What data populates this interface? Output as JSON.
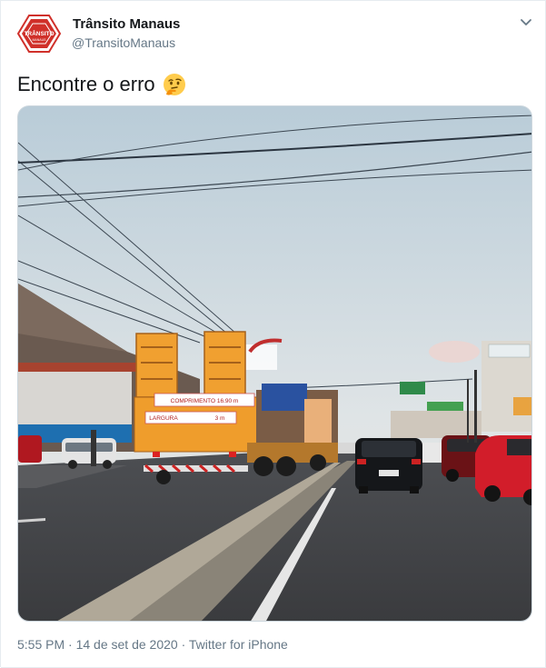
{
  "tweet": {
    "author": {
      "name": "Trânsito Manaus",
      "handle": "@TransitoManaus",
      "avatar_text": "TRÂNSITO",
      "avatar_subtext": "MANAUS",
      "avatar_color": "#d0302a"
    },
    "text": "Encontre o erro",
    "emoji": "thinking-face-icon",
    "photo_signs": {
      "top": "COMPRIMENTO 16.90 m",
      "bottom": "LARGURA",
      "bottom_value": "3 m"
    },
    "meta": {
      "time": "5:55 PM",
      "separator": " · ",
      "date": "14 de set de 2020",
      "source": "Twitter for iPhone"
    },
    "colors": {
      "text_primary": "#14171a",
      "text_secondary": "#657786",
      "border": "#e6ecf0",
      "truck": "#f0a030"
    }
  }
}
